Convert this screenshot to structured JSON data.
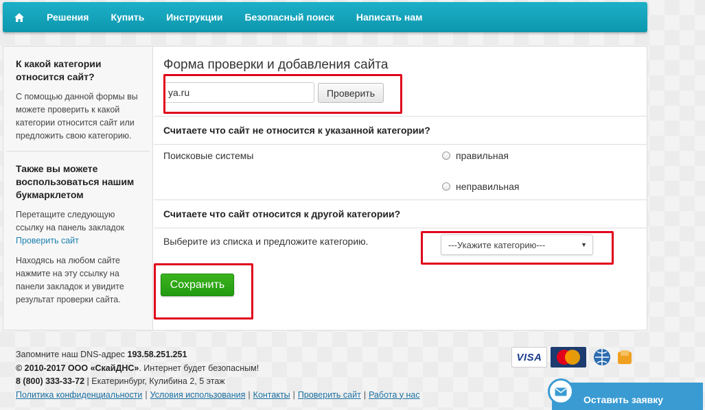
{
  "nav": {
    "items": [
      "Решения",
      "Купить",
      "Инструкции",
      "Безопасный поиск",
      "Написать нам"
    ]
  },
  "sidebar": {
    "block1_title": "К какой категории относится сайт?",
    "block1_text": "С помощью данной формы вы можете проверить к какой категории относится сайт или предложить свою категорию.",
    "block2_title": "Также вы можете воспользоваться нашим букмарклетом",
    "block2_text1": "Перетащите следующую ссылку на панель закладок",
    "bookmarklet_link": "Проверить сайт",
    "block2_text2": "Находясь на любом сайте нажмите на эту ссылку на панели закладок и увидите результат проверки сайта."
  },
  "form": {
    "title": "Форма проверки и добавления сайта",
    "site_value": "ya.ru",
    "check_button": "Проверить",
    "section1_heading": "Считаете что сайт не относится к указанной категории?",
    "current_category": "Поисковые системы",
    "radio_correct": "правильная",
    "radio_incorrect": "неправильная",
    "section2_heading": "Считаете что сайт относится к другой категории?",
    "suggest_text": "Выберите из списка и предложите категорию.",
    "select_value": "---Укажите категорию---",
    "save_button": "Сохранить"
  },
  "footer": {
    "dns_label": "Запомните наш DNS-адрес",
    "dns_value": "193.58.251.251",
    "copyright_bold": "© 2010-2017 ООО «СкайДНС»",
    "copyright_rest": ". Интернет будет безопасным!",
    "phone": "8 (800) 333-33-72",
    "address": " | Екатеринбург, Кулибина 2, 5 этаж",
    "links": [
      "Политика конфиденциальности",
      "Условия использования",
      "Контакты",
      "Проверить сайт",
      "Работа у нас"
    ],
    "visa_text": "VISA",
    "mc_text": "MasterCard",
    "order_button": "Оставить заявку"
  },
  "colors": {
    "nav": "#14a4bc",
    "save": "#2ea614",
    "highlight": "#e0001a",
    "link": "#1a7fb0"
  }
}
